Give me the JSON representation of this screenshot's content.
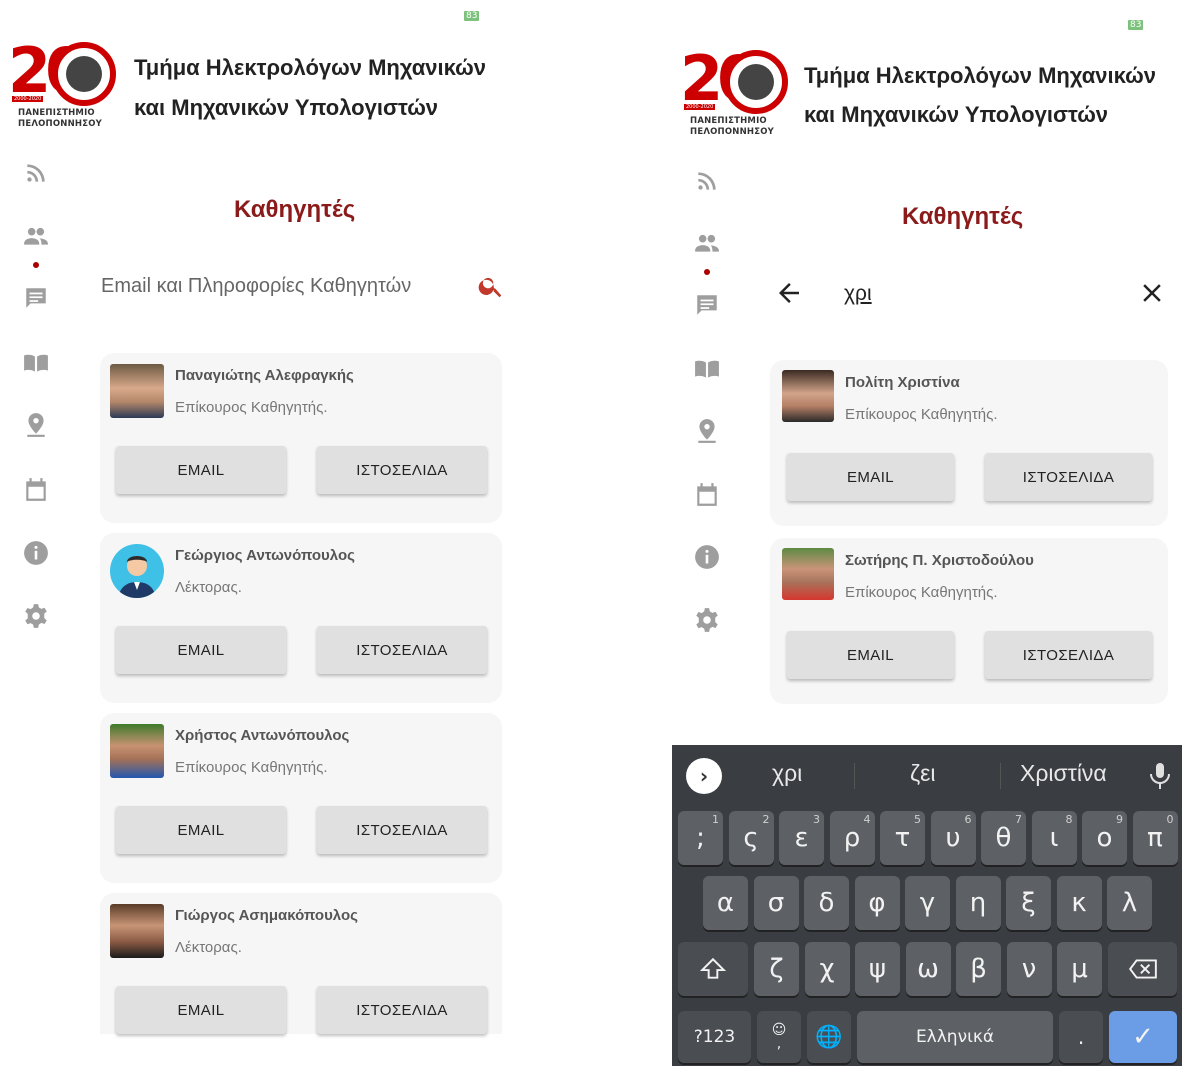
{
  "left": {
    "status": {
      "battery": "83"
    },
    "logo": {
      "number": "20",
      "years": "2000-2020",
      "university_line1": "ΠΑΝΕΠΙΣΤΗΜΙΟ",
      "university_line2": "ΠΕΛΟΠΟΝΝΗΣΟΥ"
    },
    "header": {
      "title_line1": "Τμήμα Ηλεκτρολόγων Μηχανικών",
      "title_line2": "και Μηχανικών Υπολογιστών"
    },
    "sidebar": [
      "rss-icon",
      "people-icon",
      "chat-icon",
      "book-icon",
      "location-icon",
      "calendar-icon",
      "info-icon",
      "settings-icon"
    ],
    "page_title": "Καθηγητές",
    "search": {
      "placeholder": "Email και Πληροφορίες Καθηγητών"
    },
    "professors": [
      {
        "name": "Παναγιώτης Αλεφραγκής",
        "role": "Επίκουρος Καθηγητής.",
        "email_label": "EMAIL",
        "web_label": "ΙΣΤΟΣΕΛΙΔΑ"
      },
      {
        "name": "Γεώργιος Αντωνόπουλος",
        "role": "Λέκτορας.",
        "email_label": "EMAIL",
        "web_label": "ΙΣΤΟΣΕΛΙΔΑ"
      },
      {
        "name": "Χρήστος Αντωνόπουλος",
        "role": "Επίκουρος Καθηγητής.",
        "email_label": "EMAIL",
        "web_label": "ΙΣΤΟΣΕΛΙΔΑ"
      },
      {
        "name": "Γιώργος Ασημακόπουλος",
        "role": "Λέκτορας.",
        "email_label": "EMAIL",
        "web_label": "ΙΣΤΟΣΕΛΙΔΑ"
      }
    ]
  },
  "right": {
    "status": {
      "battery": "83"
    },
    "logo": {
      "number": "20",
      "years": "2000-2020",
      "university_line1": "ΠΑΝΕΠΙΣΤΗΜΙΟ",
      "university_line2": "ΠΕΛΟΠΟΝΝΗΣΟΥ"
    },
    "header": {
      "title_line1": "Τμήμα Ηλεκτρολόγων Μηχανικών",
      "title_line2": "και Μηχανικών Υπολογιστών"
    },
    "page_title": "Καθηγητές",
    "search": {
      "query": "χρι"
    },
    "professors": [
      {
        "name": "Πολίτη Χριστίνα",
        "role": "Επίκουρος Καθηγητής.",
        "email_label": "EMAIL",
        "web_label": "ΙΣΤΟΣΕΛΙΔΑ"
      },
      {
        "name": "Σωτήρης Π. Χριστοδούλου",
        "role": "Επίκουρος Καθηγητής.",
        "email_label": "EMAIL",
        "web_label": "ΙΣΤΟΣΕΛΙΔΑ"
      }
    ],
    "keyboard": {
      "suggestions": [
        "χρι",
        "ζει",
        "Χριστίνα"
      ],
      "row1": [
        {
          "k": ";",
          "h": "1"
        },
        {
          "k": "ς",
          "h": "2"
        },
        {
          "k": "ε",
          "h": "3"
        },
        {
          "k": "ρ",
          "h": "4"
        },
        {
          "k": "τ",
          "h": "5"
        },
        {
          "k": "υ",
          "h": "6"
        },
        {
          "k": "θ",
          "h": "7"
        },
        {
          "k": "ι",
          "h": "8"
        },
        {
          "k": "ο",
          "h": "9"
        },
        {
          "k": "π",
          "h": "0"
        }
      ],
      "row2": [
        "α",
        "σ",
        "δ",
        "φ",
        "γ",
        "η",
        "ξ",
        "κ",
        "λ"
      ],
      "row3": [
        "ζ",
        "χ",
        "ψ",
        "ω",
        "β",
        "ν",
        "μ"
      ],
      "symbols_label": "?123",
      "emoji_comma": ",",
      "space_label": "Ελληνικά",
      "period": "."
    }
  },
  "colors": {
    "accent": "#8b1a1a",
    "search_icon": "#c0392b",
    "card_bg": "#f6f6f6",
    "button_bg": "#e0e0e0",
    "keyboard_bg": "#3a3d42",
    "enter_key": "#6b9ce6"
  }
}
